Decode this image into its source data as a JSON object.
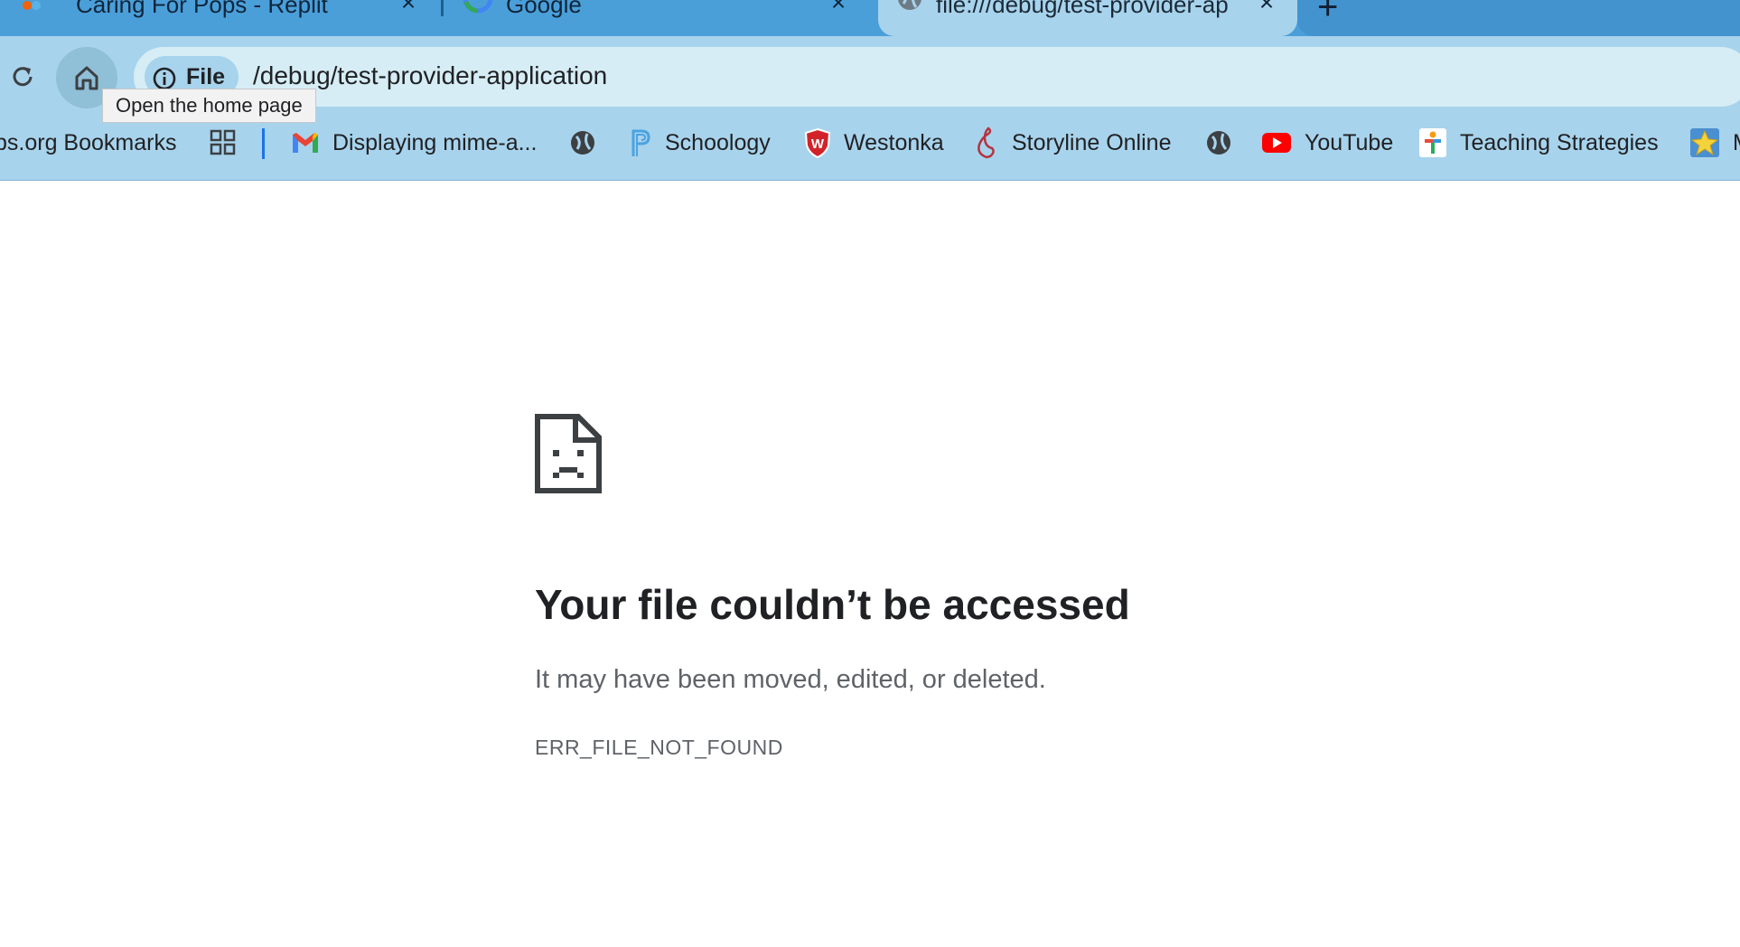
{
  "tabs": [
    {
      "title": "Caring For Pops - Replit",
      "favicon": "replit-icon"
    },
    {
      "title": "Google",
      "favicon": "google-icon"
    },
    {
      "title": "file:///debug/test-provider-ap",
      "favicon": "globe-icon",
      "active": true
    }
  ],
  "toolbar": {
    "home_tooltip": "Open the home page",
    "chip_label": "File",
    "url": "/debug/test-provider-application"
  },
  "bookmarks": [
    {
      "label": "ps.org Bookmarks",
      "icon": "none"
    },
    {
      "label": "",
      "icon": "apps-grid-icon"
    },
    {
      "label": "Displaying mime-a...",
      "icon": "gmail-icon"
    },
    {
      "label": "",
      "icon": "globe-icon"
    },
    {
      "label": "Schoology",
      "icon": "schoology-icon"
    },
    {
      "label": "Westonka",
      "icon": "westonka-shield-icon"
    },
    {
      "label": "Storyline Online",
      "icon": "storyline-icon"
    },
    {
      "label": "",
      "icon": "globe-icon"
    },
    {
      "label": "YouTube",
      "icon": "youtube-icon"
    },
    {
      "label": "Teaching Strategies",
      "icon": "teaching-strategies-icon"
    },
    {
      "label": "M",
      "icon": "star-icon"
    }
  ],
  "error": {
    "title": "Your file couldn’t be accessed",
    "description": "It may have been moved, edited, or deleted.",
    "code": "ERR_FILE_NOT_FOUND"
  },
  "colors": {
    "tabstrip": "#4a9fd9",
    "toolbar": "#a8d3ec",
    "omnibox": "#d6edf5",
    "title_text": "#202124",
    "secondary_text": "#5f6368"
  }
}
